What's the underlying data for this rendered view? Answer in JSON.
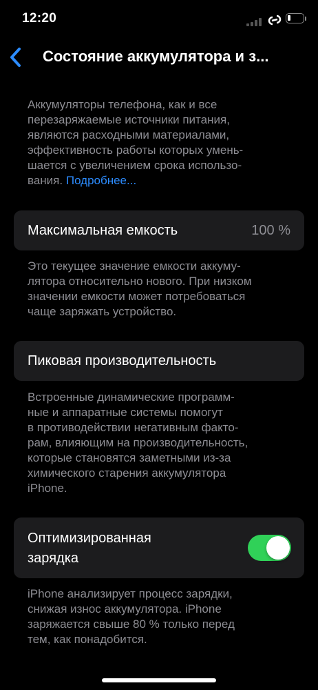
{
  "status_bar": {
    "time": "12:20",
    "icons": [
      "signal-icon",
      "link-icon",
      "battery-icon"
    ]
  },
  "nav": {
    "back_icon": "chevron-left-icon",
    "title": "Состояние аккумулятора и з..."
  },
  "intro": {
    "lines": [
      "Аккумуляторы телефона, как и все",
      "перезаряжаемые источники питания,",
      "являются расходными материалами,",
      "эффективность работы которых умень-",
      "шается с увеличением срока использо-"
    ],
    "last_line_prefix": "вания.",
    "link": "Подробнее..."
  },
  "max_capacity": {
    "label": "Максимальная емкость",
    "value": "100 %",
    "description_lines": [
      "Это текущее значение емкости аккуму-",
      "лятора относительно нового. При низком",
      "значении емкости может потребоваться",
      "чаще заряжать устройство."
    ]
  },
  "peak_performance": {
    "label": "Пиковая производительность",
    "description_lines": [
      "Встроенные динамические программ-",
      "ные и аппаратные системы помогут",
      "в противодействии негативным факто-",
      "рам, влияющим на производительность,",
      "которые становятся заметными из-за",
      "химического старения аккумулятора",
      "iPhone."
    ]
  },
  "optimized_charging": {
    "label_lines": [
      "Оптимизированная",
      "зарядка"
    ],
    "enabled": true,
    "toggle_color": "#30d158",
    "description_lines": [
      "iPhone анализирует процесс зарядки,",
      "снижая износ аккумулятора. iPhone",
      "заряжается свыше 80 % только перед",
      "тем, как понадобится."
    ]
  },
  "colors": {
    "background": "#000000",
    "cell": "#1c1c1e",
    "secondary_text": "#8d8d93",
    "link": "#2c8cff"
  }
}
